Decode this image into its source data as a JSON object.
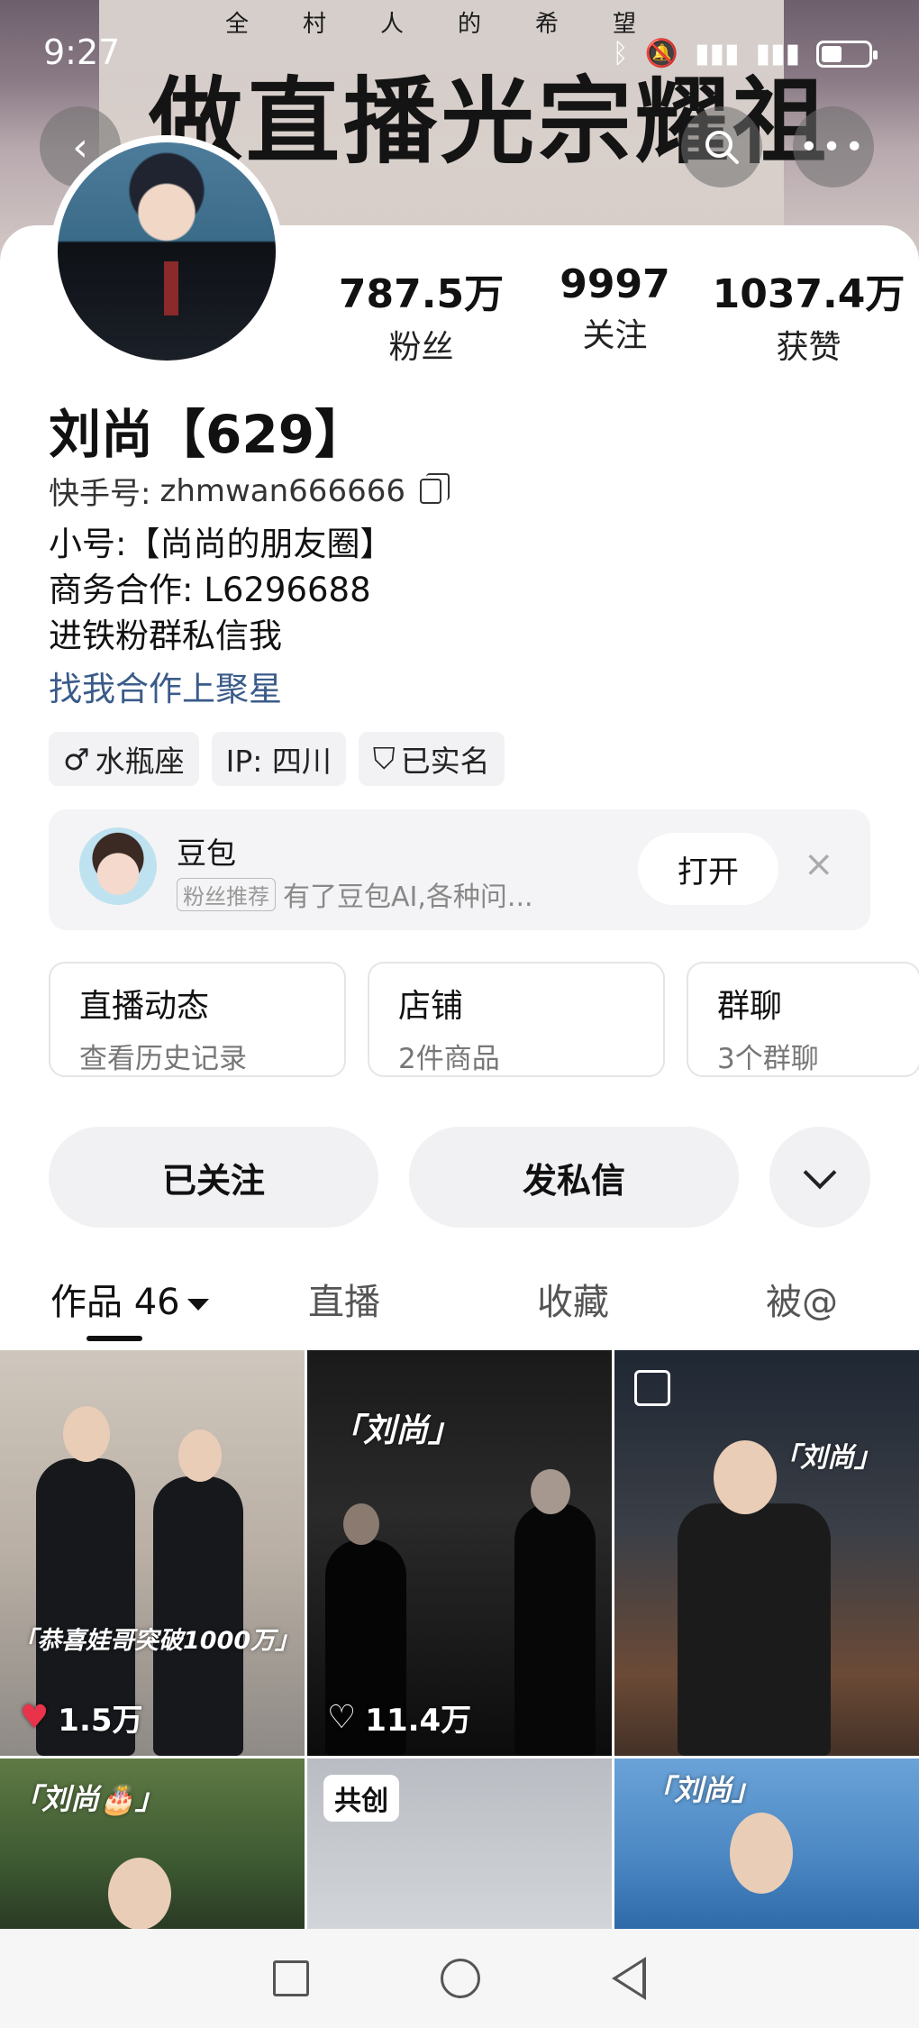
{
  "status": {
    "time": "9:27"
  },
  "banner": {
    "small_text": "全村人的希望",
    "big_text": "做直播光宗耀祖"
  },
  "profile": {
    "name": "刘尚【629】",
    "kuaishou_id_label": "快手号:",
    "kuaishou_id": "zhmwan666666",
    "bio_lines": [
      "小号:【尚尚的朋友圈】",
      "商务合作: L6296688",
      "进铁粉群私信我"
    ],
    "bio_link": "找我合作上聚星",
    "tags": [
      "水瓶座",
      "IP: 四川",
      "已实名"
    ]
  },
  "stats": [
    {
      "value": "787.5万",
      "label": "粉丝"
    },
    {
      "value": "9997",
      "label": "关注"
    },
    {
      "value": "1037.4万",
      "label": "获赞"
    }
  ],
  "ai_card": {
    "name": "豆包",
    "badge": "粉丝推荐",
    "desc": "有了豆包AI,各种问...",
    "open_label": "打开",
    "close": "×"
  },
  "shortcuts": [
    {
      "title": "直播动态",
      "sub": "查看历史记录"
    },
    {
      "title": "店铺",
      "sub": "2件商品"
    },
    {
      "title": "群聊",
      "sub": "3个群聊"
    }
  ],
  "actions": {
    "follow": "已关注",
    "message": "发私信"
  },
  "tabs": [
    {
      "label": "作品 46"
    },
    {
      "label": "直播"
    },
    {
      "label": "收藏"
    },
    {
      "label": "被@"
    }
  ],
  "grid": [
    {
      "caption": "「恭喜娃哥突破1000万」",
      "likes": "1.5万",
      "liked": true
    },
    {
      "caption": "「刘尚」",
      "likes": "11.4万",
      "liked": false
    },
    {
      "caption": "「刘尚」",
      "likes": "",
      "liked": false
    },
    {
      "caption": "「刘尚🎂」",
      "likes": "",
      "liked": false
    },
    {
      "caption": "",
      "badge": "共创",
      "likes": "",
      "liked": false
    },
    {
      "caption": "「刘尚」",
      "likes": "",
      "liked": false
    }
  ],
  "colors": {
    "link": "#3a5b8a",
    "like_red": "#e8334a"
  }
}
